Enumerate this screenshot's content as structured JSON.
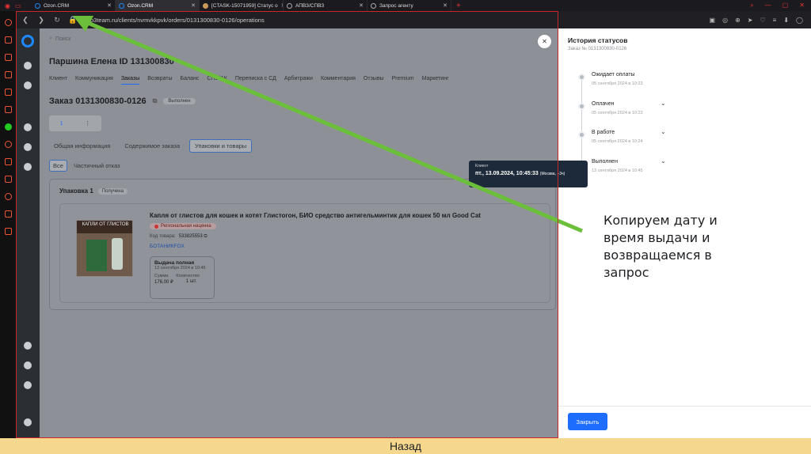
{
  "browser": {
    "tabs": [
      {
        "label": "Ozon.CRM",
        "active": false
      },
      {
        "label": "Ozon.CRM",
        "active": true
      },
      {
        "label": "[CTASK-15071959] Статус о",
        "active": false
      },
      {
        "label": "АПВЗ/СПВЗ",
        "active": false
      },
      {
        "label": "Запрос агенту",
        "active": false
      }
    ],
    "url": "o3team.ru/clients/nvmvkkpvk/orders/0131300830-0126/operations"
  },
  "app": {
    "search_placeholder": "Поиск",
    "client_name": "Паршина Елена   ID 131300830",
    "client_tabs": [
      "Клиент",
      "Коммуникация",
      "Заказы",
      "Возвраты",
      "Баланс",
      "СПВ/АК",
      "Переписка с СД",
      "Арбитражи",
      "Комментария",
      "Отзывы",
      "Premium",
      "Маркетинг"
    ],
    "client_tab_active": "Заказы",
    "order_title": "Заказ 0131300830-0126",
    "order_status": "Выполнен",
    "pager_value": "1",
    "order_tabs": [
      "Общая информация",
      "Содержимое заказа",
      "Упаковки и товары"
    ],
    "order_tab_active": "Упаковки и товары",
    "filter_tabs": [
      "Все",
      "Частичный отказ"
    ],
    "filter_tab_active": "Все",
    "package": {
      "title": "Упаковка 1",
      "status": "Получена",
      "image_text": "КАПЛИ ОТ ГЛИСТОВ",
      "item_name": "Капля от глистов для кошек и котят Глистогон, БИО средство антигельминтик для кошек 50 мл Good Cat",
      "badge": "Региональная наценка",
      "code_label": "Код товара:",
      "code_value": "533825553",
      "seller": "БОТАНИКFOX",
      "issue": {
        "title": "Выдача полная",
        "date": "13 сентября 2024 в 10:45",
        "sum_label": "Сумма",
        "qty_label": "Количество",
        "sum_value": "176,00 ₽",
        "qty_value": "1 шт."
      }
    }
  },
  "panel": {
    "title": "История статусов",
    "subtitle": "Заказ № 0131300830-0126",
    "statuses": [
      {
        "label": "Ожидает оплаты",
        "date": "05 сентября 2024 в 10:23",
        "expandable": false
      },
      {
        "label": "Оплачен",
        "date": "05 сентября 2024 в 10:23",
        "expandable": true
      },
      {
        "label": "В работе",
        "date": "05 сентября 2024 в 10:24",
        "expandable": true
      },
      {
        "label": "Выполнен",
        "date": "13 сентября 2024 в 10:45",
        "expandable": true
      }
    ],
    "close_label": "Закрыть"
  },
  "tooltip": {
    "key": "Клиент",
    "value": "пт., 13.09.2024, 10:45:33",
    "tz": "(Москва, +3ч)"
  },
  "annotation": "Копируем дату и время выдачи и возвращаемся в запрос",
  "footer": {
    "back_label": "Назад"
  },
  "colors": {
    "accent": "#1e6dff",
    "arrow": "#6cbf3a",
    "footer": "#f5d88e",
    "frame": "#c62828"
  }
}
